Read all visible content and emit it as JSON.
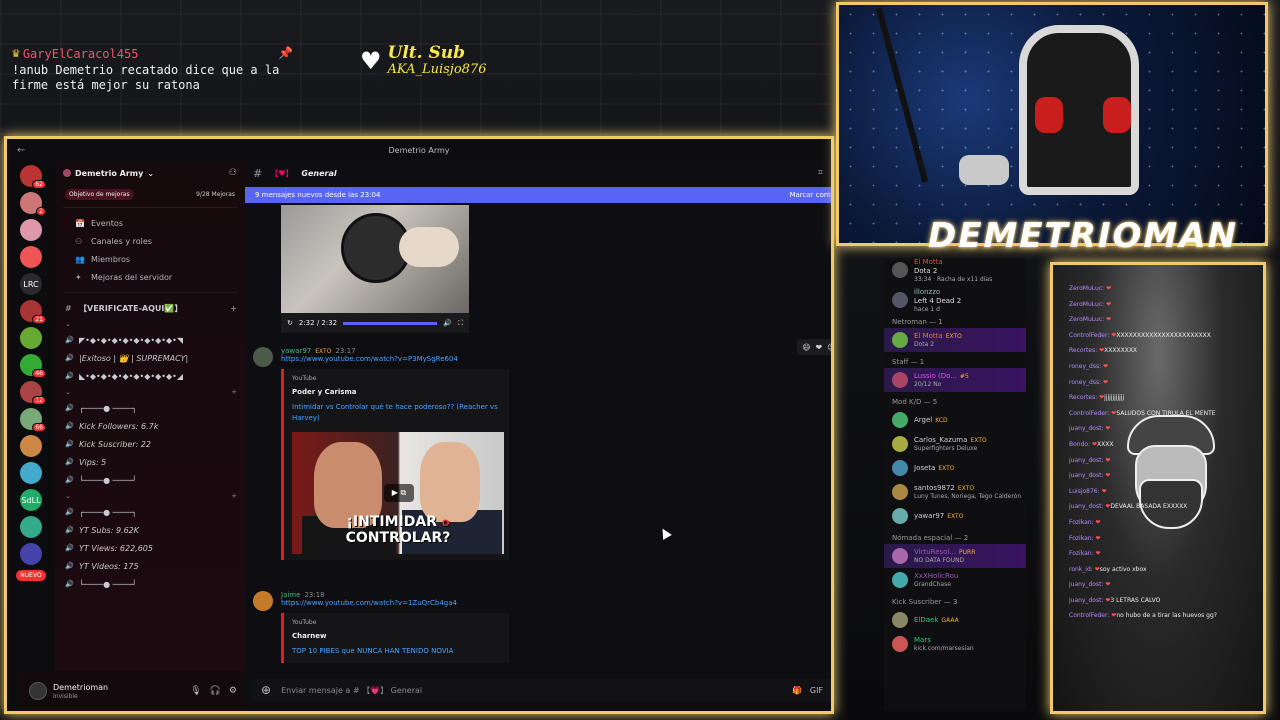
{
  "overlay": {
    "chat_user": "GaryElCaracol455",
    "chat_message": "!anub Demetrio recatado dice que a la firme está mejor su ratona",
    "ult_sub_title": "Ult. Sub",
    "ult_sub_name": "AKA_Luisjo876",
    "streamer_name": "DEMETRIOMAN"
  },
  "discord": {
    "window_title": "Demetrio Army",
    "server_name": "Demetrio Army",
    "boost_label": "Objetivo de mejoras",
    "boost_count": "9/28 Mejoras",
    "nav": [
      "Eventos",
      "Canales y roles",
      "Miembros",
      "Mejoras del servidor"
    ],
    "verify_channel": "【VERIFICATE-AQUI✅】",
    "channels_1": [
      "◤•◆•◆•◆•◆•◆•◆•◆•◆•◥",
      "|Exitoso | 👑 | SUPREMACY|",
      "◣•◆•◆•◆•◆•◆•◆•◆•◆•◢"
    ],
    "channels_2": [
      "┌────● ────┐",
      "Kick Followers: 6.7k",
      "Kick Suscriber: 22",
      "Vips: 5",
      "└────● ────┘"
    ],
    "channels_3": [
      "┌────● ────┐",
      "YT Subs: 9.62K",
      "YT Views: 622,605",
      "YT Videos: 175",
      "└────● ────┘"
    ],
    "user_name": "Demetrioman",
    "user_status": "Invisible",
    "channel_name": "General",
    "new_messages": "9 mensajes nuevos desde las 23:04",
    "mark_read": "Marcar como",
    "video_time": "2:32 / 2:32",
    "video_progress": 1.0,
    "messages": [
      {
        "author": "yawar97",
        "tag": "EXTO",
        "time": "23:17",
        "link": "https://www.youtube.com/watch?v=P3MySgRe604",
        "provider": "YouTube",
        "channel": "Poder y Carisma",
        "title": "Intimidar vs Controlar qué te hace poderoso?? (Reacher vs Harvey)",
        "thumb_text_1": "¡INTIMIDAR",
        "thumb_text_o": "O",
        "thumb_text_2": "CONTROLAR?"
      },
      {
        "author": "Jaime",
        "time": "23:18",
        "link": "https://www.youtube.com/watch?v=1ZuQrCb4ga4",
        "provider": "YouTube",
        "channel": "Charnew",
        "title": "TOP 10 PIBES que NUNCA HAN TENIDO NOVIA"
      }
    ],
    "composer_placeholder": "Enviar mensaje a # 【💗】 General",
    "server_badges": [
      "62",
      "2",
      "",
      "",
      "",
      "21",
      "",
      "46",
      "12",
      "66",
      "",
      "",
      "21",
      "",
      ""
    ],
    "srv_lrc": "LRC",
    "srv_sdl": "SdLL",
    "srv_new": "NUEVO"
  },
  "members": {
    "top": [
      {
        "name": "El Motta",
        "game": "Dota 2",
        "detail": "33:34 · Racha de x11 días"
      },
      {
        "name": "illonzzo",
        "game": "Left 4 Dead 2",
        "detail": "hace 1 d"
      }
    ],
    "groups": [
      {
        "title": "Netroman — 1",
        "items": [
          {
            "name": "El Motta",
            "tag": "EXTO",
            "sub": "Dota 2"
          }
        ]
      },
      {
        "title": "Staff — 1",
        "items": [
          {
            "name": "Lussio (Do...",
            "tag": "#5",
            "sub": "20/12 No"
          }
        ]
      },
      {
        "title": "Mod K/D — 5",
        "items": [
          {
            "name": "Argel",
            "tag": "KCD",
            "sub": ""
          },
          {
            "name": "Carlos_Kazuma",
            "tag": "EXTO",
            "sub": "Superfighters Deluxe"
          },
          {
            "name": "Joseta",
            "tag": "EXTO",
            "sub": ""
          },
          {
            "name": "santos9872",
            "tag": "EXTO",
            "sub": "Luny Tunes, Noriega, Tego Calderón"
          },
          {
            "name": "yawar97",
            "tag": "EXTO",
            "sub": ""
          }
        ]
      },
      {
        "title": "Nómada espacial — 2",
        "items": [
          {
            "name": "VirtuResol...",
            "tag": "PURR",
            "sub": "NO DATA FOUND"
          },
          {
            "name": "XxXHolicRou",
            "tag": "",
            "sub": "GrandChase"
          }
        ]
      },
      {
        "title": "Kick Suscriber — 3",
        "items": [
          {
            "name": "ElDaek",
            "tag": "GAAA",
            "sub": ""
          },
          {
            "name": "Mars",
            "tag": "",
            "sub": "kick.com/marsesian"
          }
        ]
      }
    ]
  },
  "twitch_chat": [
    {
      "u": "ZeroMuLuc:",
      "m": ""
    },
    {
      "u": "ZeroMuLuc:",
      "m": ""
    },
    {
      "u": "ZeroMuLuc:",
      "m": ""
    },
    {
      "u": "ControlFeder:",
      "m": "XXXXXXXXXXXXXXXXXXXXXXX"
    },
    {
      "u": "Recortes:",
      "m": "XXXXXXXX"
    },
    {
      "u": "roney_dss:",
      "m": ""
    },
    {
      "u": "roney_dss:",
      "m": ""
    },
    {
      "u": "Recortes:",
      "m": "jjjjjjjjjjjj"
    },
    {
      "u": "ControlFeder:",
      "m": "SALUDOS CON TIRULA EL MENTE"
    },
    {
      "u": "juany_dost:",
      "m": ""
    },
    {
      "u": "Bondo:",
      "m": "XXXX"
    },
    {
      "u": "juany_dost:",
      "m": ""
    },
    {
      "u": "juany_dost:",
      "m": ""
    },
    {
      "u": "Luisjo876:",
      "m": ""
    },
    {
      "u": "juany_dost:",
      "m": "DEVAAL BASADA EXXXXX"
    },
    {
      "u": "Fozikan:",
      "m": ""
    },
    {
      "u": "Fozikan:",
      "m": ""
    },
    {
      "u": "Fozikan:",
      "m": ""
    },
    {
      "u": "ronk_id:",
      "m": "soy activo xbox"
    },
    {
      "u": "juany_dost:",
      "m": ""
    },
    {
      "u": "juany_dost:",
      "m": "3 LETRAS CALVO"
    },
    {
      "u": "ControlFeder:",
      "m": "no hubo de a tirar las huevos gg?"
    }
  ]
}
